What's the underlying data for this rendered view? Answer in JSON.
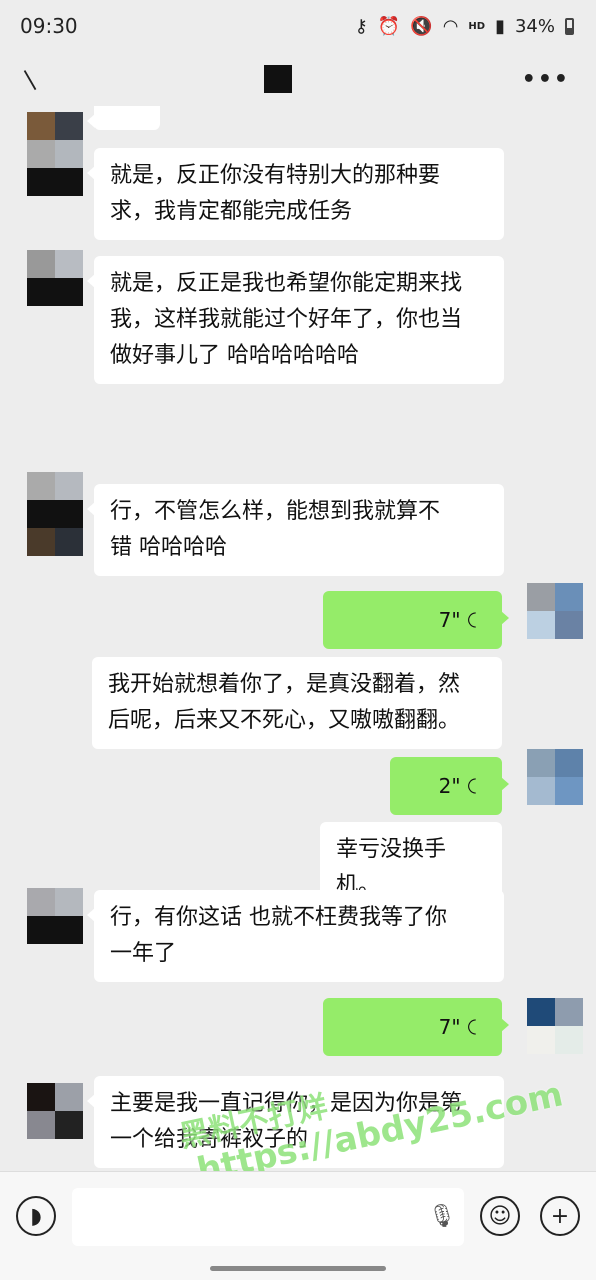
{
  "status_bar": {
    "time": "09:30",
    "icons": [
      "key-icon",
      "alarm-icon",
      "mute-icon",
      "wifi-icon",
      "hd-icon",
      "signal-icon",
      "battery-icon"
    ],
    "hd_label": "HD",
    "battery": "34%"
  },
  "title_bar": {
    "back_icon": "back-icon",
    "more_label": "•••"
  },
  "messages": [
    {
      "side": "in",
      "text": ""
    },
    {
      "side": "in",
      "text": "就是，反正你没有特别大的那种要\n求，我肯定都能完成任务"
    },
    {
      "side": "in",
      "text": "就是，反正是我也希望你能定期来找\n我，这样我就能过个好年了，你也当\n做好事儿了 哈哈哈哈哈哈"
    },
    {
      "side": "in",
      "text": "行，不管怎么样，能想到我就算不\n错 哈哈哈哈"
    },
    {
      "side": "out",
      "type": "voice",
      "duration": "7\""
    },
    {
      "side": "out",
      "text": "我开始就想着你了，是真没翻着，然\n后呢，后来又不死心，又嗷嗷翻翻。"
    },
    {
      "side": "out",
      "type": "voice",
      "duration": "2\""
    },
    {
      "side": "out",
      "text": "幸亏没换手机。"
    },
    {
      "side": "in",
      "text": "行，有你这话 也就不枉费我等了你\n一年了"
    },
    {
      "side": "out",
      "type": "voice",
      "duration": "7\""
    },
    {
      "side": "in",
      "text": "主要是我一直记得你，是因为你是第\n一个给我寄裤衩子的"
    }
  ],
  "watermark": {
    "line1": "黑料不打烊",
    "line2": "https://abdy25.com"
  },
  "input_bar": {
    "voice_icon": "voice-mode-icon",
    "mic_icon": "mic-icon",
    "emoji_icon": "emoji-icon",
    "plus_icon": "plus-icon",
    "placeholder": ""
  },
  "colors": {
    "background": "#ededed",
    "incoming_bubble": "#ffffff",
    "voice_bubble": "#95ec69",
    "watermark": "#8ee27a"
  }
}
